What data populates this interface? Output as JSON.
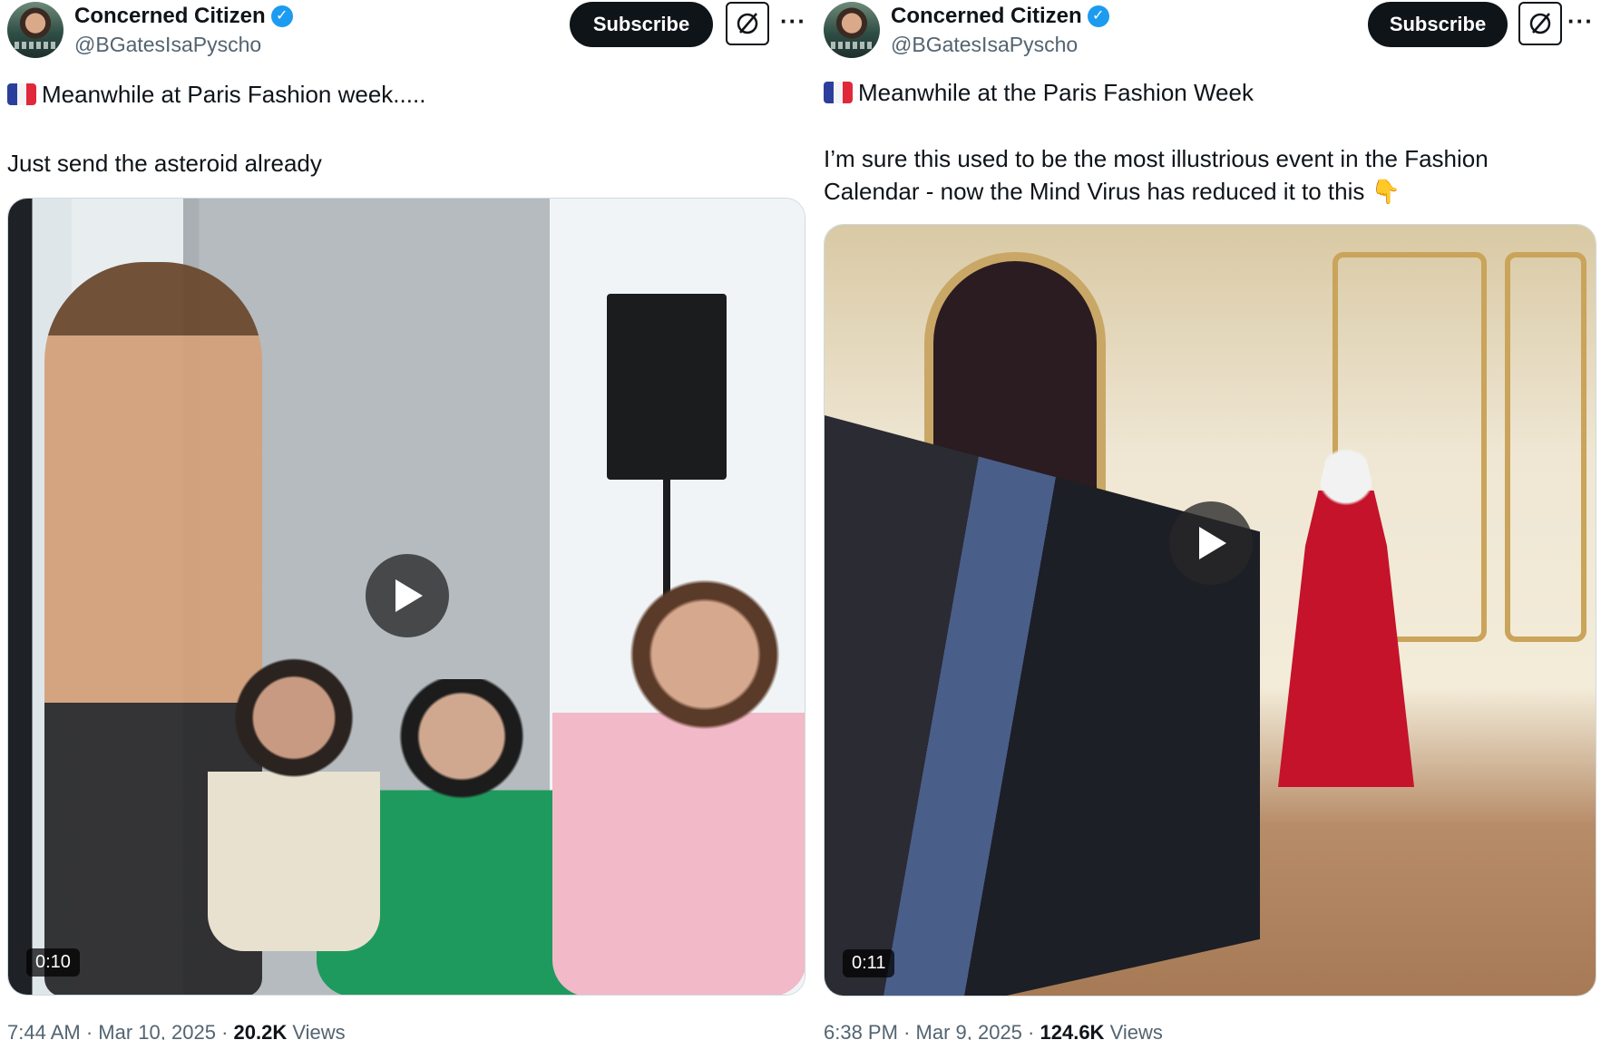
{
  "tweets": [
    {
      "author": {
        "display_name": "Concerned Citizen",
        "handle": "@BGatesIsaPyscho"
      },
      "subscribe_label": "Subscribe",
      "more_label": "···",
      "text_line1": "Meanwhile at Paris Fashion week.....",
      "text_line2": "Just send the asteroid already",
      "video_duration": "0:10",
      "time": "7:44 AM",
      "separator": "·",
      "date": "Mar 10, 2025",
      "views_count": "20.2K",
      "views_label": "Views"
    },
    {
      "author": {
        "display_name": "Concerned Citizen",
        "handle": "@BGatesIsaPyscho"
      },
      "subscribe_label": "Subscribe",
      "more_label": "···",
      "text_line1": "Meanwhile at the Paris Fashion Week",
      "text_line2": "I’m sure this used to be the most illustrious event in the Fashion",
      "text_line3": "Calendar - now the Mind Virus has reduced it to this 👇",
      "video_duration": "0:11",
      "time": "6:38 PM",
      "separator": "·",
      "date": "Mar 9, 2025",
      "views_count": "124.6K",
      "views_label": "Views"
    }
  ],
  "icons": {
    "verified": "verified-badge-icon",
    "grok": "grok-icon",
    "more": "more-options-icon",
    "play": "play-icon",
    "flag": "france-flag-icon"
  },
  "colors": {
    "text": "#0f1419",
    "secondary": "#536471",
    "verified": "#1d9bf0",
    "button": "#0f1419"
  }
}
